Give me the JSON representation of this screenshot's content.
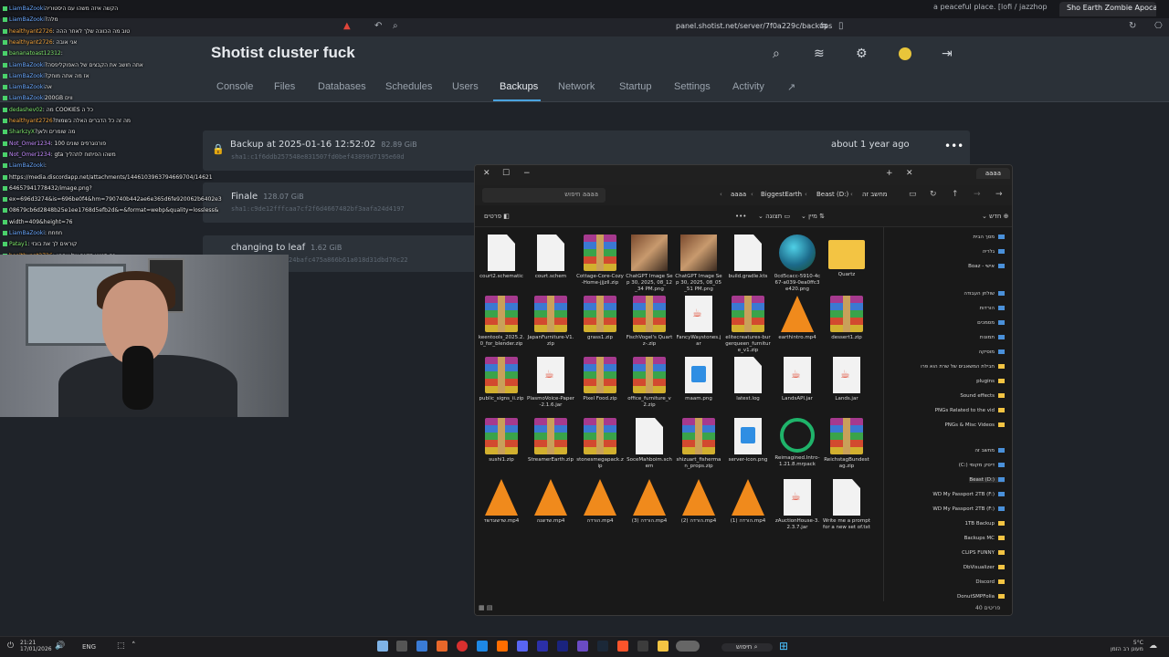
{
  "browser": {
    "tabs": [
      "a peaceful place. [lofi / jazzhop",
      "Sho Earth Zombie Apocalypse |"
    ],
    "url": "panel.shotist.net/server/7f0a229c/backups"
  },
  "panel": {
    "title": "Shotist cluster fuck",
    "nav": [
      "Console",
      "Files",
      "Databases",
      "Schedules",
      "Users",
      "Backups",
      "Network",
      "Startup",
      "Settings",
      "Activity"
    ],
    "backups": [
      {
        "name": "Backup at 2025-01-16 12:52:02",
        "size": "82.89 GiB",
        "hash": "sha1:c1f6ddb257548e831507fd0bef43899d7195e60d",
        "age": "about 1 year ago"
      },
      {
        "name": "Finale",
        "size": "128.07 GiB",
        "hash": "sha1:c9de12fffcaa7cf2f6d4667482bf3aafa24d4197",
        "age": ""
      },
      {
        "name": "changing to leaf",
        "size": "1.62 GiB",
        "hash": "24bafc475a866b61a018d31dbd70c22",
        "age": ""
      }
    ]
  },
  "chat": [
    {
      "user": "LiamBaZooki",
      "msg": "הקשה איזה משהו עם היסטוריה",
      "c": "b"
    },
    {
      "user": "LiamBaZooki",
      "msg": "?מלה",
      "c": "b"
    },
    {
      "user": "healthyant2726",
      "msg": ": טוב מה הכוונה שלך לאחר ההה",
      "c": "o"
    },
    {
      "user": "healthyant2726",
      "msg": ": אני אובה",
      "c": "o"
    },
    {
      "user": "bananatoast12312",
      "msg": ":",
      "c": "g"
    },
    {
      "user": "LiamBaZooki",
      "msg": "?אתה חושב את הקבצים של האפוקליפסה",
      "c": "b"
    },
    {
      "user": "LiamBaZooki",
      "msg": "?אז מה אתה מוחק",
      "c": "b"
    },
    {
      "user": "LiamBaZooki",
      "msg": "אה",
      "c": "b"
    },
    {
      "user": "LiamBaZooki",
      "msg": "200GB ווים",
      "c": "b"
    },
    {
      "user": "dedashev02",
      "msg": ": מה COOKIES כל ה",
      "c": "g"
    },
    {
      "user": "healthyant2726",
      "msg": "?מה זה כל הדברים האלה בשמות",
      "c": "o"
    },
    {
      "user": "SharkzyX",
      "msg": "?מה שומרים ולאן",
      "c": "g"
    },
    {
      "user": "Not_Omer1234",
      "msg": ": 100 פורנוגרפים שונים",
      "c": "p"
    },
    {
      "user": "Not_Omer1234",
      "msg": ": gta משהו הפיתוח לתהליך",
      "c": "p"
    },
    {
      "user": "LiamBaZooki",
      "msg": ":",
      "c": "b"
    },
    {
      "user": "",
      "msg": "https://media.discordapp.net/attachments/1446103963794669704/14621",
      "c": "g"
    },
    {
      "user": "",
      "msg": "64657941778432/image.png?",
      "c": "g"
    },
    {
      "user": "",
      "msg": "ex=696d3274&is=696be0f4&hm=790740b442ae6e365d6fe920062b6402e3",
      "c": "g"
    },
    {
      "user": "",
      "msg": "08679cb6d2848b25e1ee1768d5efb2d&=&format=webp&quality=lossless&",
      "c": "g"
    },
    {
      "user": "",
      "msg": "width=409&height=76",
      "c": "g"
    },
    {
      "user": "LiamBaZooki",
      "msg": ": nnnn",
      "c": "b"
    },
    {
      "user": "Patay1",
      "msg": ": קוראים לך את בונזי",
      "c": "g"
    },
    {
      "user": "healthyant2726",
      "msg": ": זה סטוש תקנה של אחרון",
      "c": "o"
    }
  ],
  "explorer": {
    "tab": "aaaa",
    "search_placeholder": "חיפוש aaaa",
    "breadcrumbs": [
      "aaaa",
      "BiggestEarth",
      "Beast (D:)",
      "מחשב זה"
    ],
    "cmd": {
      "new": "חדש",
      "view": "תצוגה",
      "sort": "מיין",
      "details": "פרטים"
    },
    "files": [
      {
        "name": "court2.schematic",
        "icon": "doc"
      },
      {
        "name": "court.schem",
        "icon": "doc"
      },
      {
        "name": "Cottage-Core-Cozy-Home-jjjzll.zip",
        "icon": "winrar"
      },
      {
        "name": "ChatGPT Image Sep 30, 2025, 08_12_34 PM.png",
        "icon": "img"
      },
      {
        "name": "ChatGPT Image Sep 30, 2025, 08_05_51 PM.png",
        "icon": "img"
      },
      {
        "name": "build.gradle.kts",
        "icon": "doc"
      },
      {
        "name": "0cd5cacc-5910-4c67-a039-0ea0ffc3e420.png",
        "icon": "globe"
      },
      {
        "name": "Quartz",
        "icon": "folder"
      },
      {
        "name": "keentools_2025.2.0_for_blender.zip",
        "icon": "winrar"
      },
      {
        "name": "JapanFurniture-V1.zip",
        "icon": "winrar"
      },
      {
        "name": "grass1.zip",
        "icon": "winrar"
      },
      {
        "name": "FischVogel's Quartz-.zip",
        "icon": "winrar"
      },
      {
        "name": "FancyWaystones.jar",
        "icon": "java"
      },
      {
        "name": "elitecreatures-burgerqueen_furniture_v1.zip",
        "icon": "winrar"
      },
      {
        "name": "earthintro.mp4",
        "icon": "vlc"
      },
      {
        "name": "dessert1.zip",
        "icon": "winrar"
      },
      {
        "name": "public_signs_ii.zip",
        "icon": "winrar"
      },
      {
        "name": "PlasmoVoice-Paper-2.1.6.jar",
        "icon": "java"
      },
      {
        "name": "Pixel Food.zip",
        "icon": "winrar"
      },
      {
        "name": "office_furniture_v2.zip",
        "icon": "winrar"
      },
      {
        "name": "maam.png",
        "icon": "blueimg"
      },
      {
        "name": "latest.log",
        "icon": "doc"
      },
      {
        "name": "LandsAPI.jar",
        "icon": "java"
      },
      {
        "name": "Lands.jar",
        "icon": "java"
      },
      {
        "name": "sushi1.zip",
        "icon": "winrar"
      },
      {
        "name": "StreamerEarth.zip",
        "icon": "winrar"
      },
      {
        "name": "stonesmegapack.zip",
        "icon": "winrar"
      },
      {
        "name": "SoceMahboim.schem",
        "icon": "doc"
      },
      {
        "name": "shizuart_fisherman_props.zip",
        "icon": "winrar"
      },
      {
        "name": "server-icon.png",
        "icon": "blueimg"
      },
      {
        "name": "Reimagined.Intro-1.21.8.mrpack",
        "icon": "green"
      },
      {
        "name": "ReichstagBundestag.zip",
        "icon": "winrar"
      },
      {
        "name": "שדשוגדשד.mp4",
        "icon": "vlc"
      },
      {
        "name": "שדשגה.mp4",
        "icon": "vlc"
      },
      {
        "name": "הורדה.mp4",
        "icon": "vlc"
      },
      {
        "name": "הורדה (3).mp4",
        "icon": "vlc"
      },
      {
        "name": "הורדה (2).mp4",
        "icon": "vlc"
      },
      {
        "name": "הורדה (1).mp4",
        "icon": "vlc"
      },
      {
        "name": "zAuctionHouse-3.2.3.7.jar",
        "icon": "java"
      },
      {
        "name": "Write me a prompt for a new set of.txt",
        "icon": "doc"
      }
    ],
    "sidebar": [
      {
        "label": "מסך הבית",
        "folder": false
      },
      {
        "label": "גלריה",
        "folder": false
      },
      {
        "label": "Boaz - אישי",
        "folder": false
      },
      {
        "label": "שולחן העבודה",
        "folder": false
      },
      {
        "label": "הורדות",
        "folder": false
      },
      {
        "label": "מסמכים",
        "folder": false
      },
      {
        "label": "תמונות",
        "folder": false
      },
      {
        "label": "מוסיקה",
        "folder": false
      },
      {
        "label": "חבילת המשאבים של שרת הוא פרו",
        "folder": true
      },
      {
        "label": "plugins",
        "folder": true
      },
      {
        "label": "Sound effects",
        "folder": true
      },
      {
        "label": "PNGs Related to the vid",
        "folder": true
      },
      {
        "label": "PNGs & Misc Videos",
        "folder": true
      },
      {
        "label": "מחשב זה",
        "folder": false
      },
      {
        "label": "(C:) דיסק מקומי",
        "folder": false
      },
      {
        "label": "Beast (D:)",
        "folder": false
      },
      {
        "label": "WD My Passport 2TB (F:)",
        "folder": false
      },
      {
        "label": "WD My Passport 2TB (F:)",
        "folder": false
      },
      {
        "label": "1TB Backup",
        "folder": true
      },
      {
        "label": "Backups MC",
        "folder": true
      },
      {
        "label": "CLIPS FUNNY",
        "folder": true
      },
      {
        "label": "DbVisualizer",
        "folder": true
      },
      {
        "label": "Discord",
        "folder": true
      },
      {
        "label": "DonutSMPFolia",
        "folder": true
      }
    ],
    "status": "40 פריטים"
  },
  "taskbar": {
    "time": "21:21",
    "date": "17/01/2026",
    "lang": "ENG",
    "search": "חיפוש",
    "weather": "5°C",
    "weather_sub": "מעונן רב הזמן"
  }
}
